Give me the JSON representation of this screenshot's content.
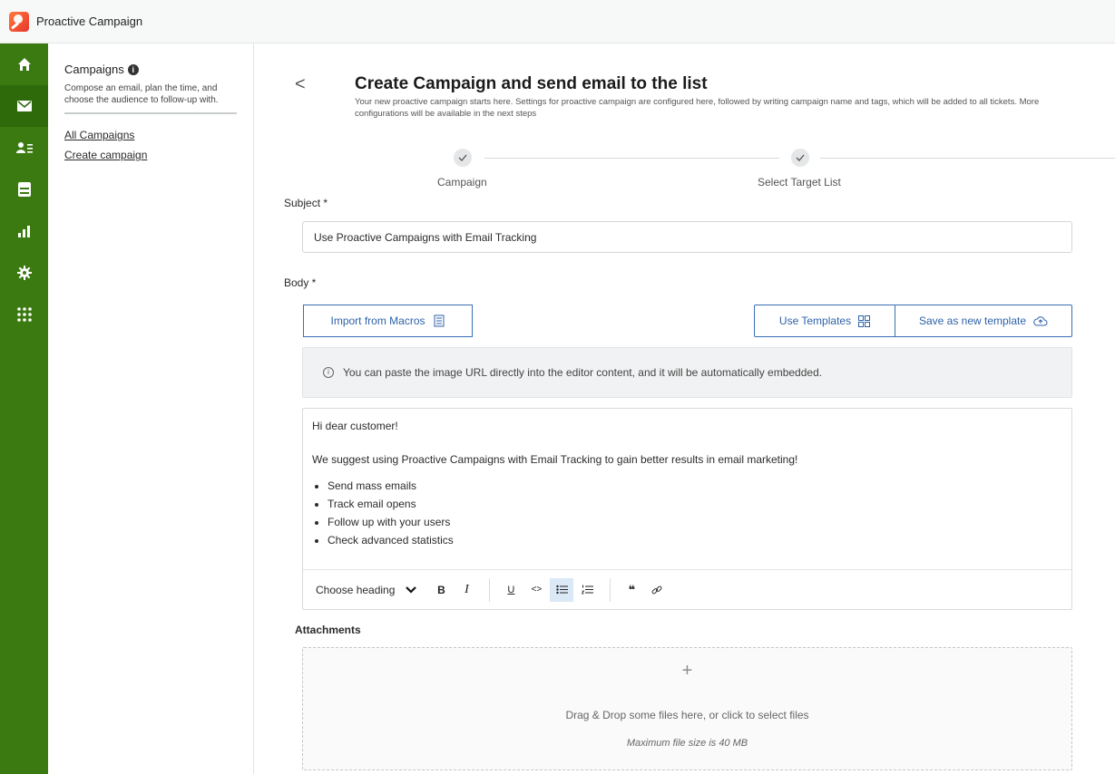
{
  "app": {
    "title": "Proactive Campaign"
  },
  "rail": {
    "items": [
      {
        "icon": "home-icon"
      },
      {
        "icon": "mail-icon",
        "active": true
      },
      {
        "icon": "contacts-icon"
      },
      {
        "icon": "inbox-icon"
      },
      {
        "icon": "chart-icon"
      },
      {
        "icon": "gear-icon"
      },
      {
        "icon": "apps-grid-icon"
      }
    ],
    "accent": "#3a7a10"
  },
  "subnav": {
    "title": "Campaigns",
    "description": "Compose an email, plan the time, and choose the audience to follow-up with.",
    "links": [
      "All Campaigns",
      "Create campaign"
    ]
  },
  "header": {
    "back": "<",
    "title": "Create Campaign and send email to the list",
    "description": "Your new proactive campaign starts here. Settings for proactive campaign are configured here, followed by writing campaign name and tags, which will be added to all tickets. More configurations will be available in the next steps"
  },
  "stepper": {
    "steps": [
      {
        "label": "Campaign",
        "done": true
      },
      {
        "label": "Select Target List",
        "done": true
      }
    ]
  },
  "form": {
    "subject_label": "Subject *",
    "subject_value": "Use Proactive Campaigns with Email Tracking",
    "body_label": "Body *",
    "import_macros": "Import from Macros",
    "use_templates": "Use Templates",
    "save_template": "Save as new template",
    "notice": "You can paste the image URL directly into the editor content, and it will be automatically embedded.",
    "body": {
      "greeting": "Hi dear customer!",
      "intro": "We suggest using Proactive Campaigns with Email Tracking to gain better results in email marketing!",
      "bullets": [
        "Send mass emails",
        "Track email opens",
        "Follow up with your users",
        "Check advanced statistics"
      ]
    },
    "toolbar": {
      "heading": "Choose heading",
      "bold": "B",
      "italic": "I",
      "underline": "U",
      "code": "<>",
      "quote": "❝"
    },
    "attachments_label": "Attachments",
    "dropzone_plus": "+",
    "dropzone_text": "Drag & Drop some files here, or click to select files",
    "dropzone_limit": "Maximum file size is 40 MB"
  }
}
